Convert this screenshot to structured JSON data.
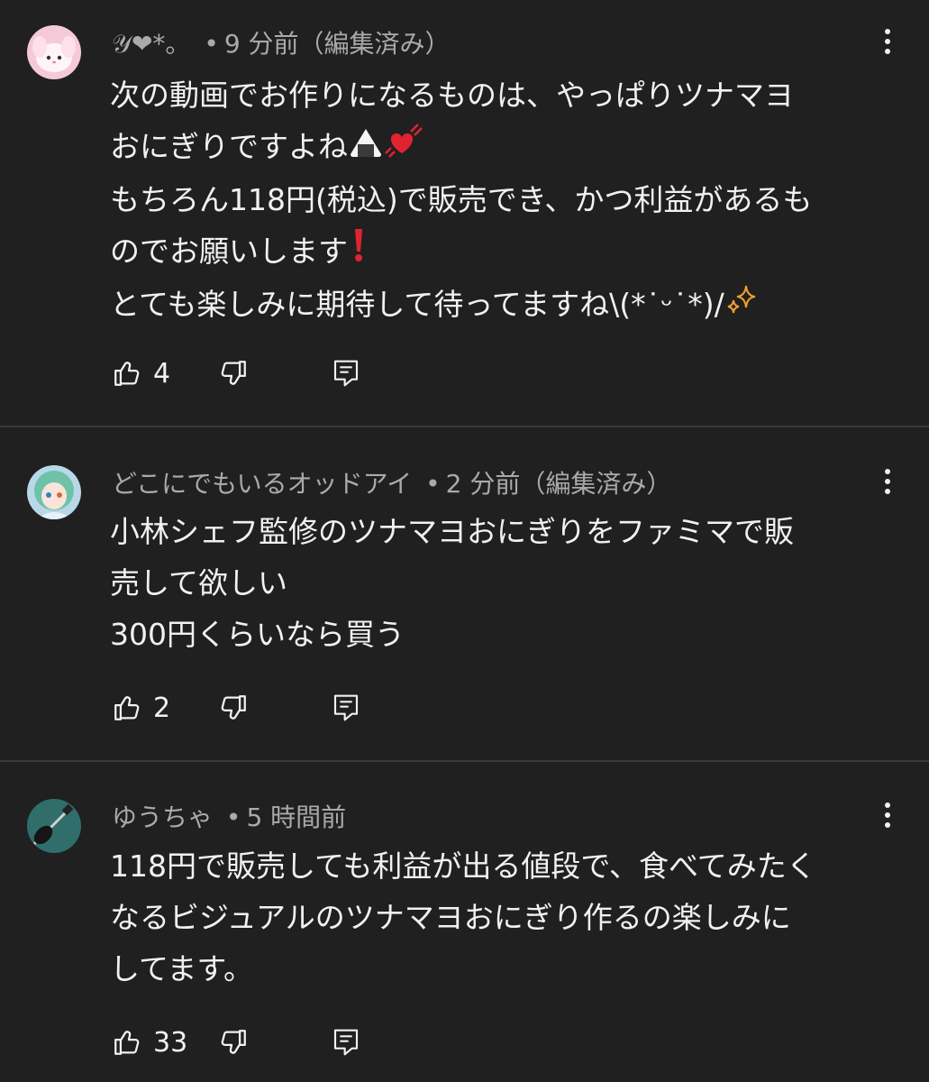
{
  "comments": [
    {
      "author": "𝒴❤*。",
      "separator": "•",
      "time": "9 分前（編集済み）",
      "lines": [
        "次の動画でお作りになるものは、やっぱりツナマヨ",
        "おにぎりですよね",
        "もちろん118円(税込)で販売でき、かつ利益があるも",
        "のでお願いします",
        "とても楽しみに期待して待ってますね\\(*˙ᵕ˙*)/"
      ],
      "likes": "4",
      "icons": [
        "rice-ball-icon",
        "heart-icon",
        "exclamation-icon",
        "sparkles-icon"
      ]
    },
    {
      "author": "どこにでもいるオッドアイ",
      "separator": "•",
      "time": "2 分前（編集済み）",
      "lines": [
        "小林シェフ監修のツナマヨおにぎりをファミマで販",
        "売して欲しい",
        "300円くらいなら買う"
      ],
      "likes": "2"
    },
    {
      "author": "ゆうちゃ",
      "separator": "•",
      "time": "5 時間前",
      "lines": [
        "118円で販売しても利益が出る値段で、食べてみたく",
        "なるビジュアルのツナマヨおにぎり作るの楽しみに",
        "してます。"
      ],
      "likes": "33"
    }
  ],
  "colors": {
    "background": "#202020",
    "text": "#f1f1f1",
    "meta": "#aaaaaa",
    "divider": "#3a3a3a"
  }
}
